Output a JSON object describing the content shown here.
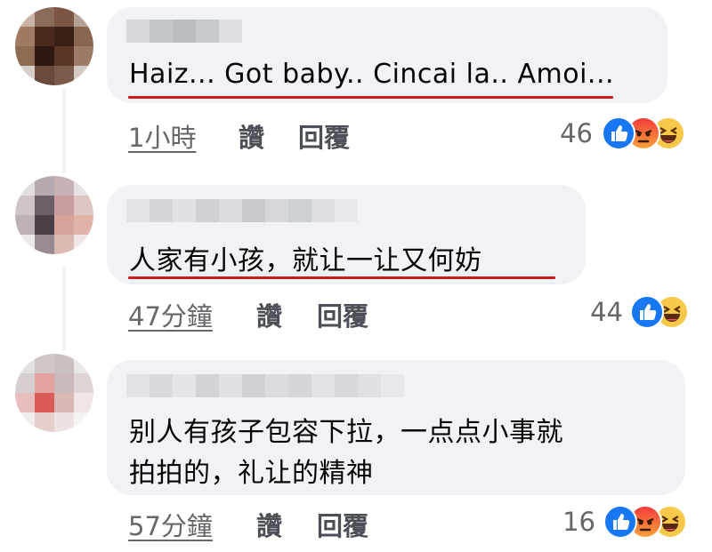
{
  "comments": [
    {
      "text": "Haiz... Got baby.. Cincai la.. Amoi...",
      "time": "1小時",
      "like_label": "讚",
      "reply_label": "回覆",
      "reaction_count": "46",
      "reactions": [
        "like-icon",
        "angry-icon",
        "haha-icon"
      ]
    },
    {
      "text": "人家有小孩，就让一让又何妨",
      "time": "47分鐘",
      "like_label": "讚",
      "reply_label": "回覆",
      "reaction_count": "44",
      "reactions": [
        "like-icon",
        "haha-icon"
      ]
    },
    {
      "text_line1": "别人有孩子包容下拉，一点点小事就",
      "text_line2": "拍拍的，礼让的精神",
      "time": "57分鐘",
      "like_label": "讚",
      "reply_label": "回覆",
      "reaction_count": "16",
      "reactions": [
        "like-icon",
        "angry-icon",
        "haha-icon"
      ]
    }
  ],
  "colors": {
    "bubble": "#f0f2f5",
    "text": "#050505",
    "meta": "#65676b",
    "underline": "#cc1b1b",
    "like": "#1877f2"
  }
}
